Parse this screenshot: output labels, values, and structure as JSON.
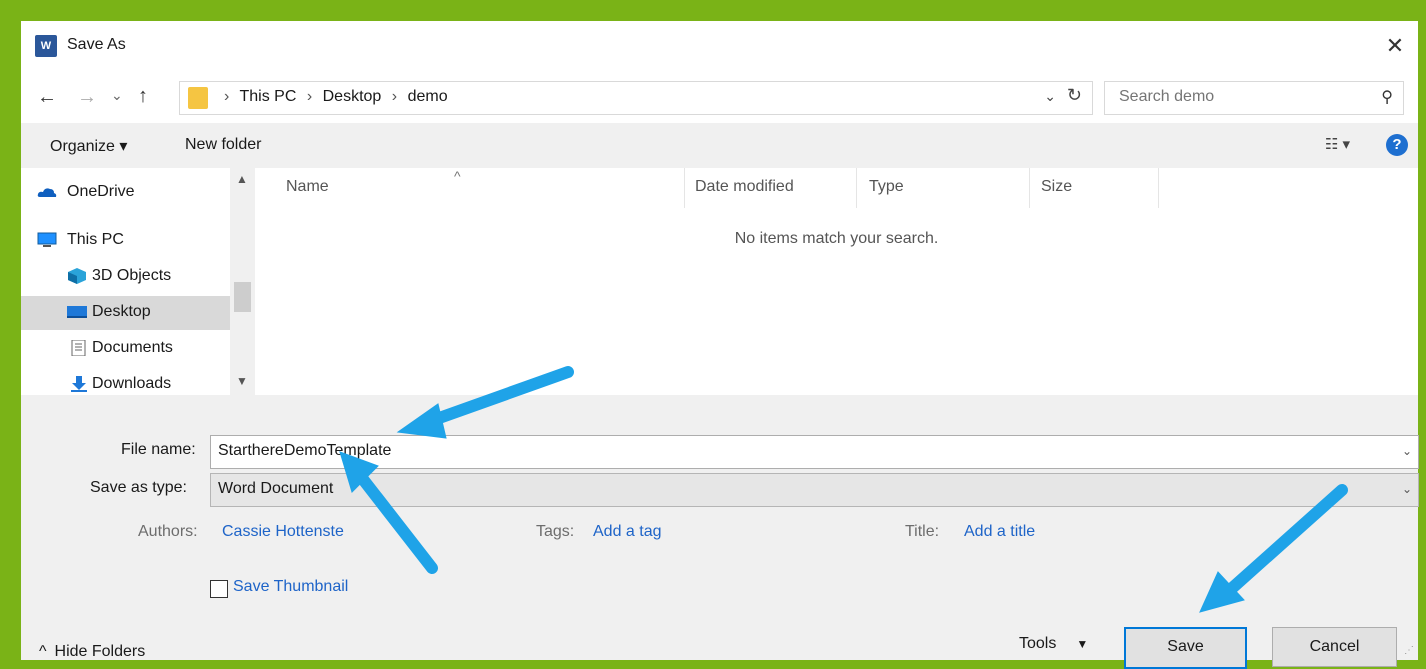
{
  "window": {
    "title": "Save As",
    "app_icon": "word-icon",
    "app_icon_letter": "W"
  },
  "address": {
    "crumbs": [
      "This PC",
      "Desktop",
      "demo"
    ]
  },
  "search": {
    "placeholder": "Search demo"
  },
  "toolbar": {
    "organize": "Organize ▾",
    "new_folder": "New folder"
  },
  "nav": {
    "items": [
      {
        "label": "OneDrive",
        "icon": "onedrive-icon"
      },
      {
        "label": "This PC",
        "icon": "computer-icon"
      },
      {
        "label": "3D Objects",
        "icon": "cube-icon"
      },
      {
        "label": "Desktop",
        "icon": "desktop-icon",
        "selected": true
      },
      {
        "label": "Documents",
        "icon": "document-icon"
      },
      {
        "label": "Downloads",
        "icon": "download-icon"
      }
    ]
  },
  "files": {
    "columns": [
      "Name",
      "Date modified",
      "Type",
      "Size"
    ],
    "empty_message": "No items match your search."
  },
  "form": {
    "file_name_label": "File name:",
    "file_name_value": "StarthereDemoTemplate",
    "save_type_label": "Save as type:",
    "save_type_value": "Word Document",
    "authors_label": "Authors:",
    "authors_value": "Cassie Hottenste",
    "tags_label": "Tags:",
    "tags_value": "Add a tag",
    "title_label": "Title:",
    "title_value": "Add a title",
    "thumbnail_label": "Save Thumbnail"
  },
  "footer": {
    "hide_folders": "Hide Folders",
    "tools": "Tools",
    "save": "Save",
    "cancel": "Cancel"
  },
  "colors": {
    "frame": "#7ab317",
    "annotation_arrow": "#1fa3e8",
    "link": "#1e64c8",
    "primary_border": "#0078d7"
  }
}
